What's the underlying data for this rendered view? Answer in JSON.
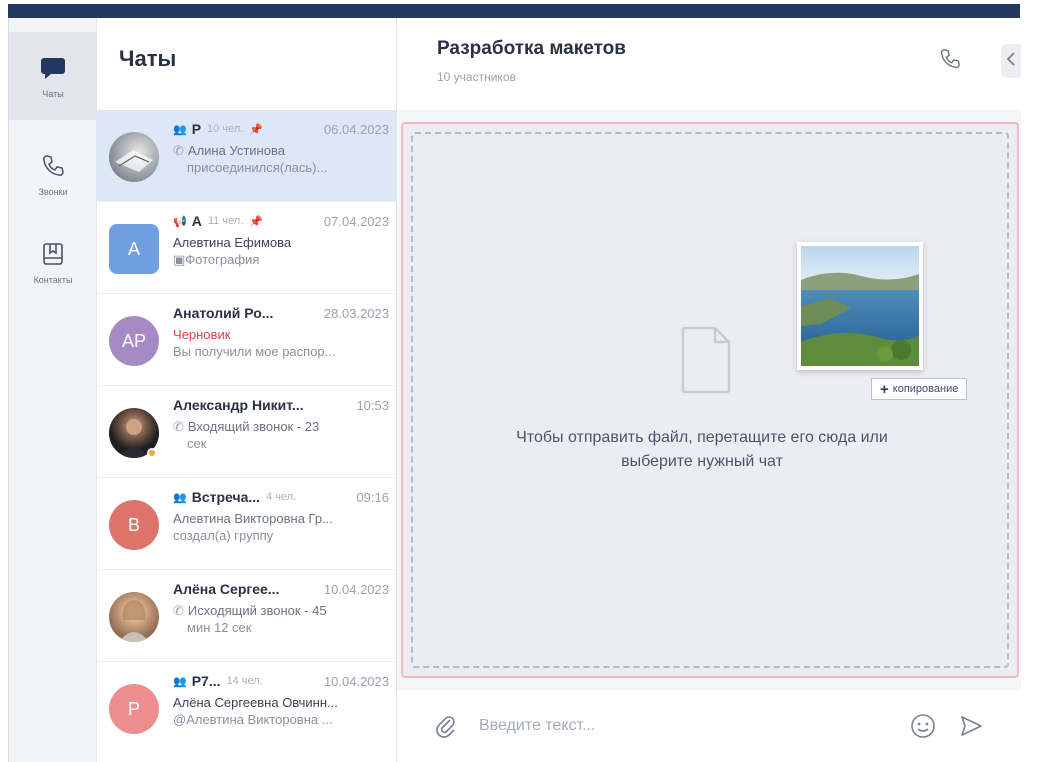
{
  "nav": {
    "items": [
      {
        "label": "Чаты",
        "icon": "chat-bubble-icon"
      },
      {
        "label": "Звонки",
        "icon": "phone-icon"
      },
      {
        "label": "Контакты",
        "icon": "contacts-book-icon"
      }
    ]
  },
  "chat_list": {
    "title": "Чаты",
    "items": [
      {
        "name": "Р",
        "kind": "group",
        "members": "10 чел.",
        "date": "06.04.2023",
        "pinned": true,
        "line2": "Алина Устинова",
        "line3": "присоединился(лась)...",
        "line2_type": "call",
        "avatar": "photo"
      },
      {
        "name": "А",
        "kind": "channel",
        "members": "11 чел.",
        "date": "07.04.2023",
        "pinned": true,
        "line2": "Алевтина Ефимова",
        "line3": "Фотография",
        "line2_type": "author",
        "avatar_letter": "A",
        "avatar_color": "#6f9fe0"
      },
      {
        "name": "Анатолий Ро...",
        "date": "28.03.2023",
        "line2": "Черновик",
        "line3": "Вы получили мое распор...",
        "line2_type": "draft",
        "avatar_letter": "AP",
        "avatar_color": "#a68ac6"
      },
      {
        "name": "Александр Никит...",
        "date": "10:53",
        "line2": "Входящий звонок - 23",
        "line3": "сек",
        "line2_type": "call",
        "avatar": "photo-dark"
      },
      {
        "name": "Встреча...",
        "kind": "group",
        "members": "4 чел.",
        "date": "09:16",
        "line2": "Алевтина Викторовна Гр...",
        "line3": "создал(а) группу",
        "line2_type": "plain",
        "avatar_letter": "B",
        "avatar_color": "#de7469"
      },
      {
        "name": "Алёна Сергее...",
        "date": "10.04.2023",
        "line2": "Исходящий звонок - 45",
        "line3": "мин 12 сек",
        "line2_type": "call",
        "avatar": "photo-woman"
      },
      {
        "name": "Р7...",
        "kind": "group-private",
        "members": "14 чел.",
        "date": "10.04.2023",
        "line2": "Алёна Сергеевна Овчинн...",
        "line3": "@Алевтина Викторовна ...",
        "line2_type": "author",
        "avatar_letter": "P",
        "avatar_color": "#ec8e8e"
      }
    ]
  },
  "main": {
    "title": "Разработка макетов",
    "subtitle": "10 участников",
    "drop_text": "Чтобы отправить файл, перетащите его сюда или выберите нужный чат",
    "copy_badge": "копирование",
    "composer_placeholder": "Введите текст..."
  },
  "colors": {
    "accent": "#243761",
    "active_chat": "#dce8f6",
    "drop_border": "#f1b9c0",
    "draft": "#d9404e"
  }
}
